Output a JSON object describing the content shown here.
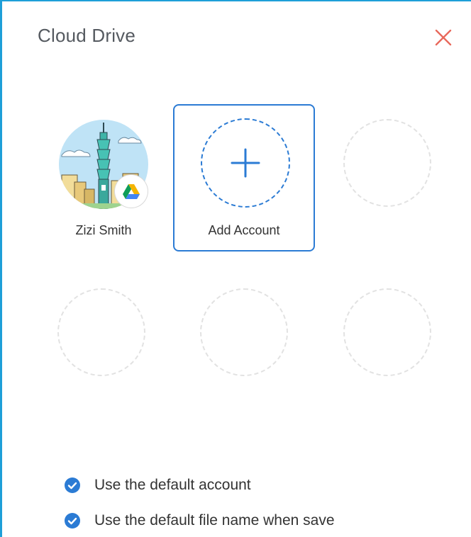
{
  "dialog": {
    "title": "Cloud Drive",
    "close_icon": "close-icon",
    "accent_color": "#2b7bd4",
    "close_color": "#e8695c"
  },
  "accounts": [
    {
      "name": "Zizi Smith",
      "avatar": "taipei-101-illustration",
      "badge_icon": "google-drive-icon"
    },
    {
      "label": "Add Account",
      "icon": "plus-icon",
      "selected": true
    }
  ],
  "options": [
    {
      "label": "Use the default account",
      "checked": true,
      "icon": "check-circle-icon"
    },
    {
      "label": "Use the default file name when save",
      "checked": true,
      "icon": "check-circle-icon"
    }
  ]
}
